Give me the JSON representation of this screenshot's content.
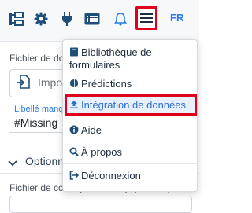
{
  "toolbar": {
    "icons": [
      "hierarchy-icon",
      "gear-icon",
      "plug-icon",
      "list-card-icon",
      "bell-icon",
      "hamburger-menu-icon"
    ],
    "language": "FR"
  },
  "background": {
    "file_label": "Fichier de donn",
    "import_button": "Impor",
    "mandatory_label": "Libellé manq",
    "missing_value": "#Missing",
    "options_title": "Optionne",
    "correspondence_label": "Fichier de correspondance (Optionnel)"
  },
  "menu": {
    "items": [
      {
        "label_line1": "Bibliothèque de",
        "label_line2": "formulaires",
        "icon": "book-icon"
      },
      {
        "label": "Prédictions",
        "icon": "brain-icon"
      },
      {
        "label": "Intégration de données",
        "icon": "upload-icon",
        "active": true
      },
      {
        "label": "Aide",
        "icon": "info-icon"
      },
      {
        "label": "À propos",
        "icon": "search-icon"
      },
      {
        "label": "Déconnexion",
        "icon": "logout-icon"
      }
    ]
  },
  "colors": {
    "accent": "#2c7be5",
    "highlight_red": "#e0001b",
    "active_bg": "#e8f0fb"
  }
}
